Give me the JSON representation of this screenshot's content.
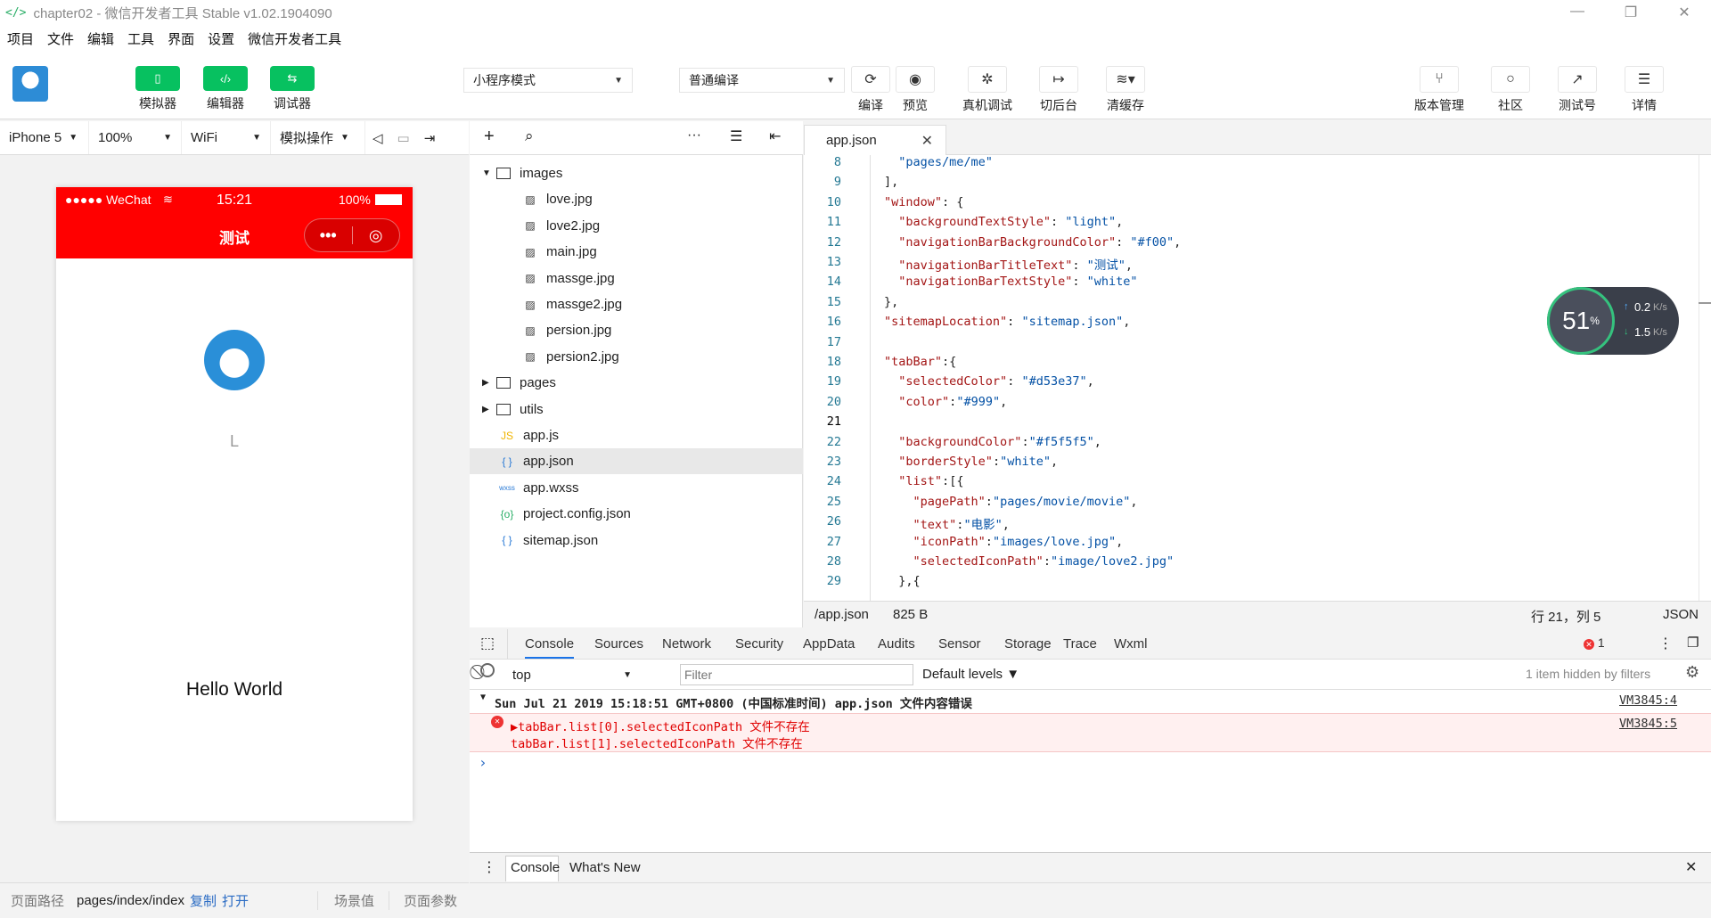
{
  "window": {
    "title": "chapter02 - 微信开发者工具 Stable v1.02.1904090",
    "min": "—",
    "max": "❐",
    "close": "✕"
  },
  "menu": [
    "项目",
    "文件",
    "编辑",
    "工具",
    "界面",
    "设置",
    "微信开发者工具"
  ],
  "toolbar": {
    "simulator": "模拟器",
    "editor": "编辑器",
    "debugger": "调试器",
    "mode": "小程序模式",
    "compile_mode": "普通编译",
    "compile": "编译",
    "preview": "预览",
    "remote_debug": "真机调试",
    "background": "切后台",
    "clear_cache": "清缓存",
    "version": "版本管理",
    "community": "社区",
    "test_account": "测试号",
    "details": "详情"
  },
  "device": {
    "model": "iPhone 5",
    "zoom": "100%",
    "network": "WiFi",
    "ops": "模拟操作"
  },
  "phone": {
    "carrier": "●●●●● WeChat",
    "time": "15:21",
    "battery": "100%",
    "nav_title": "测试",
    "user_name": "L",
    "hello": "Hello World"
  },
  "left_status": {
    "path_label": "页面路径",
    "path": "pages/index/index",
    "copy": "复制",
    "open": "打开",
    "scene": "场景值",
    "params": "页面参数"
  },
  "tree": [
    {
      "name": "images",
      "type": "folder-open",
      "level": 0
    },
    {
      "name": "love.jpg",
      "type": "image",
      "level": 1
    },
    {
      "name": "love2.jpg",
      "type": "image",
      "level": 1
    },
    {
      "name": "main.jpg",
      "type": "image",
      "level": 1
    },
    {
      "name": "massge.jpg",
      "type": "image",
      "level": 1
    },
    {
      "name": "massge2.jpg",
      "type": "image",
      "level": 1
    },
    {
      "name": "persion.jpg",
      "type": "image",
      "level": 1
    },
    {
      "name": "persion2.jpg",
      "type": "image",
      "level": 1
    },
    {
      "name": "pages",
      "type": "folder",
      "level": 0
    },
    {
      "name": "utils",
      "type": "folder",
      "level": 0
    },
    {
      "name": "app.js",
      "type": "js",
      "level": 0
    },
    {
      "name": "app.json",
      "type": "json",
      "level": 0,
      "selected": true
    },
    {
      "name": "app.wxss",
      "type": "wxss",
      "level": 0
    },
    {
      "name": "project.config.json",
      "type": "config",
      "level": 0
    },
    {
      "name": "sitemap.json",
      "type": "json",
      "level": 0
    }
  ],
  "editor": {
    "tab": "app.json",
    "lines": [
      {
        "n": "8",
        "t": "  \"pages/me/me\""
      },
      {
        "n": "9",
        "t": "],"
      },
      {
        "n": "10",
        "t": "\"window\": {"
      },
      {
        "n": "11",
        "t": "  \"backgroundTextStyle\": \"light\","
      },
      {
        "n": "12",
        "t": "  \"navigationBarBackgroundColor\": \"#f00\","
      },
      {
        "n": "13",
        "t": "  \"navigationBarTitleText\": \"测试\","
      },
      {
        "n": "14",
        "t": "  \"navigationBarTextStyle\": \"white\""
      },
      {
        "n": "15",
        "t": "},"
      },
      {
        "n": "16",
        "t": "\"sitemapLocation\": \"sitemap.json\","
      },
      {
        "n": "17",
        "t": ""
      },
      {
        "n": "18",
        "t": "\"tabBar\":{"
      },
      {
        "n": "19",
        "t": "  \"selectedColor\": \"#d53e37\","
      },
      {
        "n": "20",
        "t": "  \"color\":\"#999\","
      },
      {
        "n": "21",
        "t": ""
      },
      {
        "n": "22",
        "t": "  \"backgroundColor\":\"#f5f5f5\","
      },
      {
        "n": "23",
        "t": "  \"borderStyle\":\"white\","
      },
      {
        "n": "24",
        "t": "  \"list\":[{"
      },
      {
        "n": "25",
        "t": "    \"pagePath\":\"pages/movie/movie\","
      },
      {
        "n": "26",
        "t": "    \"text\":\"电影\","
      },
      {
        "n": "27",
        "t": "    \"iconPath\":\"images/love.jpg\","
      },
      {
        "n": "28",
        "t": "    \"selectedIconPath\":\"image/love2.jpg\""
      },
      {
        "n": "29",
        "t": "  },{"
      }
    ],
    "status_path": "/app.json",
    "status_size": "825 B",
    "status_pos": "行 21，列 5",
    "status_lang": "JSON"
  },
  "speed": {
    "percent": "51",
    "unit": "%",
    "up": "0.2",
    "down": "1.5",
    "rate_unit": "K/s"
  },
  "devtools": {
    "tabs": [
      "Console",
      "Sources",
      "Network",
      "Security",
      "AppData",
      "Audits",
      "Sensor",
      "Storage",
      "Trace",
      "Wxml"
    ],
    "error_count": "1",
    "context": "top",
    "filter_placeholder": "Filter",
    "levels": "Default levels",
    "hidden": "1 item hidden by filters",
    "log_header": "Sun Jul 21 2019 15:18:51 GMT+0800 (中国标准时间)  app.json 文件内容错误",
    "log_header_src": "VM3845:4",
    "err1": "▶tabBar.list[0].selectedIconPath 文件不存在",
    "err2": "tabBar.list[1].selectedIconPath 文件不存在",
    "err_src": "VM3845:5",
    "prompt": "›",
    "bottom_tabs": [
      "Console",
      "What's New"
    ]
  },
  "colors": {
    "nav_red": "#ff0000",
    "green": "#07c160",
    "error_bg": "#fff0f0",
    "error_text": "#e00000"
  }
}
